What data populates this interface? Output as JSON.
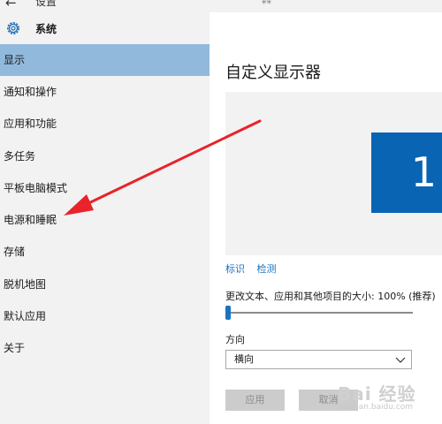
{
  "window": {
    "title": "设置",
    "back_glyph": "←"
  },
  "sidebar": {
    "header_label": "系统",
    "items": [
      {
        "label": "显示",
        "selected": true
      },
      {
        "label": "通知和操作"
      },
      {
        "label": "应用和功能"
      },
      {
        "label": "多任务"
      },
      {
        "label": "平板电脑模式"
      },
      {
        "label": "电源和睡眠"
      },
      {
        "label": "存储"
      },
      {
        "label": "脱机地图"
      },
      {
        "label": "默认应用"
      },
      {
        "label": "关于"
      }
    ]
  },
  "main": {
    "title": "自定义显示器",
    "monitor_number": "1",
    "links": {
      "identify": "标识",
      "detect": "检测"
    },
    "scale_label": "更改文本、应用和其他项目的大小: 100% (推荐)",
    "scale_value_fraction": 0.0,
    "orientation_label": "方向",
    "orientation_value": "横向",
    "apply_label": "应用",
    "cancel_label": "取消"
  },
  "watermark": {
    "logo": "Bai 经验",
    "url": "jingyan.baidu.com"
  },
  "colors": {
    "selected_bg": "#91b9dc",
    "accent": "#0a64b4",
    "annotation_arrow": "#e8232a"
  },
  "icons": {
    "gear": "gear-icon",
    "back": "back-arrow-icon",
    "chevron": "chevron-down-icon"
  }
}
